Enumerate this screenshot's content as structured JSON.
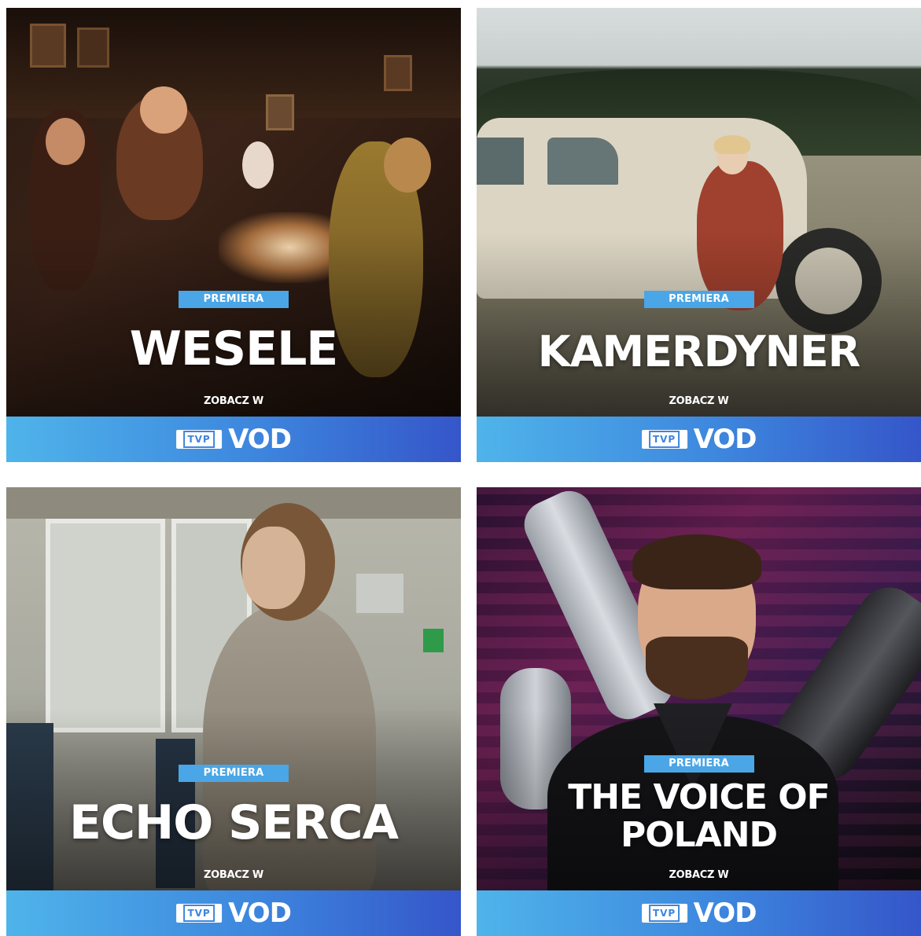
{
  "tiles": [
    {
      "badge": "PREMIERA",
      "title": "WESELE",
      "cta": "ZOBACZ W",
      "brand": {
        "tvp": "TVP",
        "vod": "VOD"
      }
    },
    {
      "badge": "PREMIERA",
      "title": "KAMERDYNER",
      "cta": "ZOBACZ W",
      "brand": {
        "tvp": "TVP",
        "vod": "VOD"
      }
    },
    {
      "badge": "PREMIERA",
      "title": "ECHO SERCA",
      "cta": "ZOBACZ W",
      "brand": {
        "tvp": "TVP",
        "vod": "VOD"
      }
    },
    {
      "badge": "PREMIERA",
      "title": "THE VOICE OF POLAND",
      "cta": "ZOBACZ W",
      "brand": {
        "tvp": "TVP",
        "vod": "VOD"
      }
    }
  ],
  "colors": {
    "badge": "#4aa6e6",
    "brand_bar_start": "#4fb4ea",
    "brand_bar_end": "#3556c9",
    "title_text": "#ffffff"
  }
}
